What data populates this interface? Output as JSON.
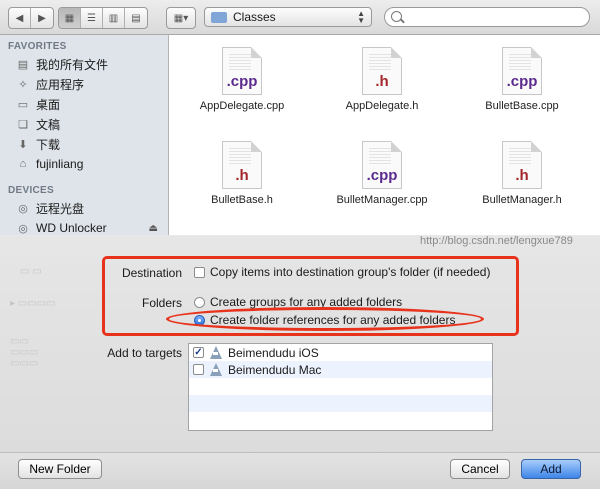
{
  "toolbar": {
    "location": "Classes",
    "search_placeholder": ""
  },
  "sidebar": {
    "favorites_header": "FAVORITES",
    "favorites": [
      {
        "label": "我的所有文件",
        "icon": "all-files-icon"
      },
      {
        "label": "应用程序",
        "icon": "applications-icon"
      },
      {
        "label": "桌面",
        "icon": "desktop-icon"
      },
      {
        "label": "文稿",
        "icon": "documents-icon"
      },
      {
        "label": "下载",
        "icon": "downloads-icon"
      },
      {
        "label": "fujinliang",
        "icon": "home-icon"
      }
    ],
    "devices_header": "DEVICES",
    "devices": [
      {
        "label": "远程光盘",
        "icon": "remote-disc-icon"
      },
      {
        "label": "WD Unlocker",
        "icon": "drive-icon"
      }
    ]
  },
  "files": [
    {
      "ext": ".cpp",
      "name": "AppDelegate.cpp"
    },
    {
      "ext": ".h",
      "name": "AppDelegate.h"
    },
    {
      "ext": ".cpp",
      "name": "BulletBase.cpp"
    },
    {
      "ext": ".h",
      "name": "BulletBase.h"
    },
    {
      "ext": ".cpp",
      "name": "BulletManager.cpp"
    },
    {
      "ext": ".h",
      "name": "BulletManager.h"
    }
  ],
  "watermark": "http://blog.csdn.net/lengxue789",
  "options": {
    "destination_label": "Destination",
    "destination_option": "Copy items into destination group's folder (if needed)",
    "folders_label": "Folders",
    "folders_option_groups": "Create groups for any added folders",
    "folders_option_references": "Create folder references for any added folders",
    "targets_label": "Add to targets",
    "targets": [
      {
        "name": "Beimendudu iOS",
        "checked": true,
        "mark": "✓"
      },
      {
        "name": "Beimendudu Mac",
        "checked": false,
        "mark": ""
      }
    ]
  },
  "buttons": {
    "new_folder": "New Folder",
    "cancel": "Cancel",
    "add": "Add"
  },
  "colors": {
    "annotation_red": "#e8331c",
    "cpp_purple": "#5b2a8e",
    "header_red": "#a3262a",
    "primary_blue": "#3d85e8"
  }
}
